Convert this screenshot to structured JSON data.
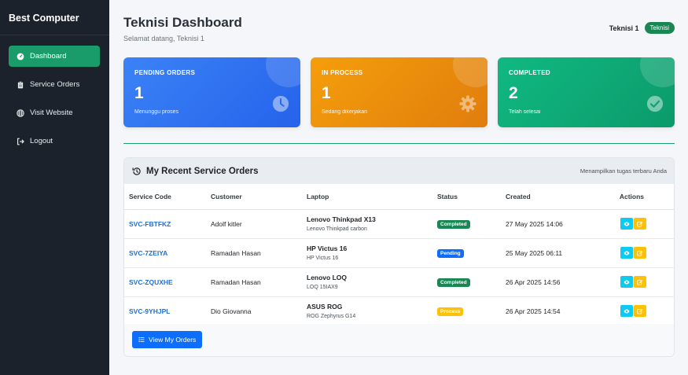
{
  "sidebar": {
    "brand": "Best Computer",
    "items": [
      {
        "label": "Dashboard",
        "icon": "dashboard-icon",
        "active": true
      },
      {
        "label": "Service Orders",
        "icon": "clipboard-icon",
        "active": false
      },
      {
        "label": "Visit Website",
        "icon": "globe-icon",
        "active": false
      },
      {
        "label": "Logout",
        "icon": "logout-icon",
        "active": false
      }
    ]
  },
  "header": {
    "title": "Teknisi Dashboard",
    "subtitle": "Selamat datang, Teknisi 1",
    "user_name": "Teknisi 1",
    "role_badge": "Teknisi"
  },
  "cards": [
    {
      "label": "PENDING ORDERS",
      "value": "1",
      "desc": "Menunggu proses",
      "icon": "clock-icon",
      "color": "#2f6fe9"
    },
    {
      "label": "IN PROCESS",
      "value": "1",
      "desc": "Sedang dikerjakan",
      "icon": "gear-icon",
      "color": "#ee8d0b"
    },
    {
      "label": "COMPLETED",
      "value": "2",
      "desc": "Telah selesai",
      "icon": "check-circle-icon",
      "color": "#0fa775"
    }
  ],
  "panel": {
    "title": "My Recent Service Orders",
    "note": "Menampilkan tugas terbaru Anda",
    "columns": [
      "Service Code",
      "Customer",
      "Laptop",
      "Status",
      "Created",
      "Actions"
    ],
    "rows": [
      {
        "code": "SVC-FBTFKZ",
        "customer": "Adolf kitler",
        "laptop": "Lenovo Thinkpad X13",
        "model": "Lenovo Thinkpad carbon",
        "status": "Completed",
        "created": "27 May 2025 14:06"
      },
      {
        "code": "SVC-7ZEIYA",
        "customer": "Ramadan Hasan",
        "laptop": "HP Victus 16",
        "model": "HP Victus 16",
        "status": "Pending",
        "created": "25 May 2025 06:11"
      },
      {
        "code": "SVC-ZQUXHE",
        "customer": "Ramadan Hasan",
        "laptop": "Lenovo LOQ",
        "model": "LOQ 15IAX9",
        "status": "Completed",
        "created": "26 Apr 2025 14:56"
      },
      {
        "code": "SVC-9YHJPL",
        "customer": "Dio Giovanna",
        "laptop": "ASUS ROG",
        "model": "ROG Zephyrus G14",
        "status": "Process",
        "created": "26 Apr 2025 14:54"
      }
    ],
    "footer_button": "View My Orders"
  },
  "colors": {
    "sidebar_bg": "#1c222b",
    "accent_green": "#1a9b6a",
    "primary_blue": "#0d6efd",
    "status_completed": "#198754",
    "status_pending": "#0d6efd",
    "status_process": "#ffc107"
  }
}
